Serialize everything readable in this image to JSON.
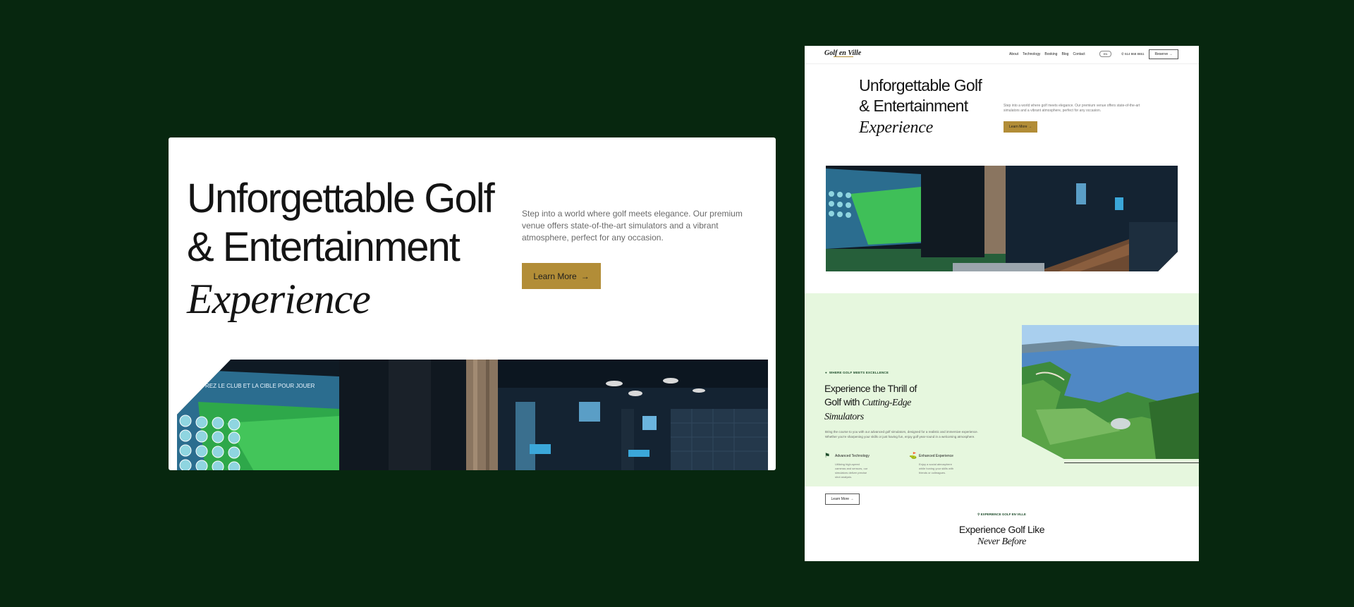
{
  "zoom": {
    "title_line1": "Unforgettable Golf",
    "title_line2": "& Entertainment",
    "title_italic": "Experience",
    "description": "Step into a world where golf meets elegance. Our premium venue offers state-of-the-art simulators and a vibrant atmosphere, perfect for any occasion.",
    "button_label": "Learn More",
    "button_arrow": "→",
    "screen_text": "REZ LE CLUB ET LA CIBLE POUR JOUER"
  },
  "full_page": {
    "nav": {
      "logo": "Golf en Ville",
      "links": [
        "About",
        "Technology",
        "Booking",
        "Blog",
        "Contact"
      ],
      "lang": "EN",
      "phone": "514 868 8651",
      "reserve_label": "Reserve →"
    },
    "hero": {
      "title_line1": "Unforgettable Golf",
      "title_line2": "& Entertainment",
      "title_italic": "Experience",
      "description": "Step into a world where golf meets elegance. Our premium venue offers state-of-the-art simulators and a vibrant atmosphere, perfect for any occasion.",
      "button_label": "Learn More →"
    },
    "section2": {
      "eyebrow": "WHERE GOLF MEETS EXCELLENCE",
      "title_line1": "Experience the Thrill of",
      "title_prefix": "Golf with ",
      "title_italic1": "Cutting-Edge",
      "title_italic2": "Simulators",
      "body": "Bring the course to you with our advanced golf simulators, designed for a realistic and immersive experience. Whether you're sharpening your skills or just having fun, enjoy golf year-round in a welcoming atmosphere.",
      "features": [
        {
          "title": "Advanced Technology",
          "desc": "Utilizing high-speed cameras and sensors, our simulators deliver precise shot analysis."
        },
        {
          "title": "Enhanced Experience",
          "desc": "Enjoy a social atmosphere while honing your skills with friends or colleagues."
        }
      ],
      "button_label": "Learn More →"
    },
    "section3": {
      "eyebrow": "EXPERIENCE GOLF EN VILLE",
      "title_line1": "Experience Golf Like",
      "title_italic": "Never Before"
    }
  },
  "colors": {
    "background": "#07270f",
    "accent_gold": "#b28d37",
    "mint": "#e6f7de",
    "text_dark": "#141414"
  }
}
